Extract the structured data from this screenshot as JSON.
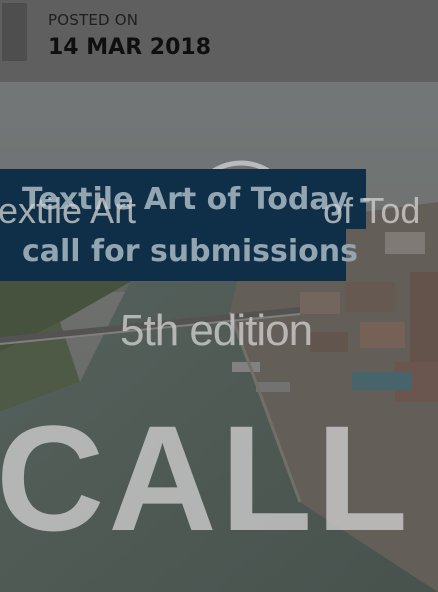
{
  "post": {
    "posted_label": "POSTED ON",
    "date": "14 MAR 2018",
    "title_line1": "Textile Art of Today -",
    "title_line2": "call for submissions"
  },
  "hero_image": {
    "text_brand_left": "extile Art",
    "text_brand_right": "of Tod",
    "text_edition": "5th  edition",
    "text_call": "CALL"
  },
  "colors": {
    "header_bg": "#686868",
    "title_card_bg": "#10344e",
    "title_text": "#9fb3c1"
  }
}
